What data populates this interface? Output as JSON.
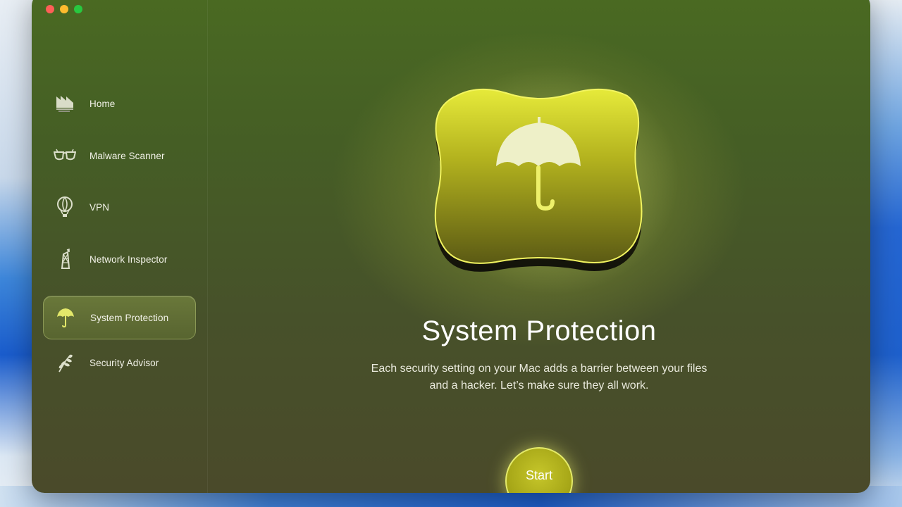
{
  "window": {
    "controls": [
      "close",
      "minimize",
      "zoom"
    ]
  },
  "sidebar": {
    "items": [
      {
        "label": "Home",
        "icon": "home-icon",
        "active": false
      },
      {
        "label": "Malware Scanner",
        "icon": "glasses-icon",
        "active": false
      },
      {
        "label": "VPN",
        "icon": "balloon-icon",
        "active": false
      },
      {
        "label": "Network Inspector",
        "icon": "network-tower-icon",
        "active": false
      },
      {
        "label": "System Protection",
        "icon": "umbrella-icon",
        "active": true
      },
      {
        "label": "Security Advisor",
        "icon": "wheat-icon",
        "active": false
      }
    ]
  },
  "main": {
    "hero_icon": "umbrella-icon",
    "title": "System Protection",
    "description_line1": "Each security setting on your Mac adds a barrier between your files",
    "description_line2": "and a hacker. Let’s make sure they all work.",
    "start_label": "Start"
  },
  "colors": {
    "accent": "#c6c62a",
    "window_background": "#47512a",
    "text": "#ffffff"
  }
}
